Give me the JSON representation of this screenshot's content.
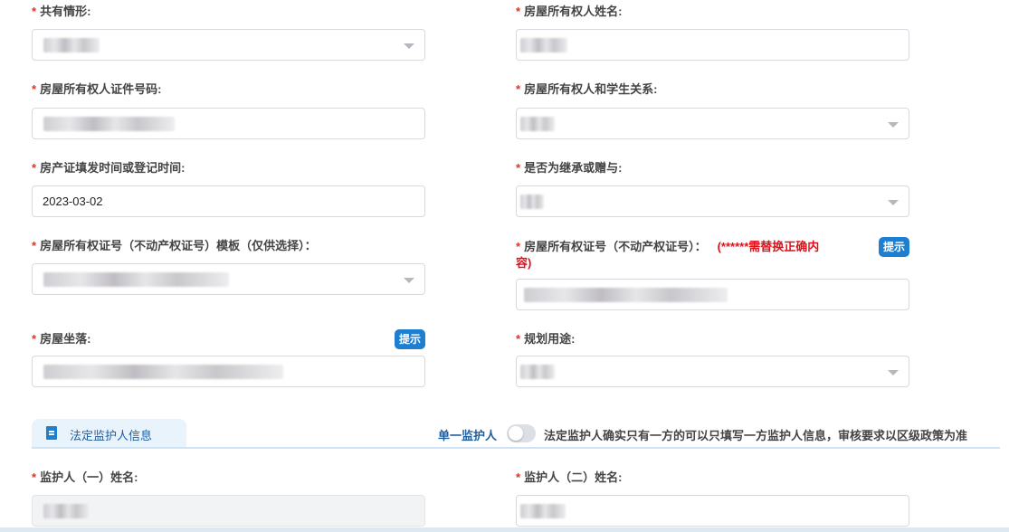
{
  "required_mark": "*",
  "fields": {
    "ownership": {
      "label": "共有情形:",
      "type": "select"
    },
    "owner_name": {
      "label": "房屋所有权人姓名:",
      "type": "input"
    },
    "owner_id_number": {
      "label": "房屋所有权人证件号码:",
      "type": "input"
    },
    "owner_relation": {
      "label": "房屋所有权人和学生关系:",
      "type": "select"
    },
    "cert_date": {
      "label": "房产证填发时间或登记时间:",
      "type": "input",
      "value": "2023-03-02"
    },
    "inherit_or_gift": {
      "label": "是否为继承或赠与:",
      "type": "select"
    },
    "cert_template": {
      "label": "房屋所有权证号（不动产权证号）模板（仅供选择）：",
      "type": "select"
    },
    "cert_number": {
      "label": "房屋所有权证号（不动产权证号）：",
      "warning_line1": "(******需替换正确内",
      "warning_line2": "容)",
      "hint_label": "提示",
      "type": "input"
    },
    "address": {
      "label": "房屋坐落:",
      "hint_label": "提示",
      "type": "input"
    },
    "planned_use": {
      "label": "规划用途:",
      "type": "select"
    },
    "guardian1_name": {
      "label": "监护人（一）姓名:",
      "type": "input",
      "disabled": true
    },
    "guardian2_name": {
      "label": "监护人（二）姓名:",
      "type": "input"
    }
  },
  "section": {
    "title": "法定监护人信息",
    "icon": "document-icon",
    "single_guardian_label": "单一监护人",
    "single_guardian_on": false,
    "note": "法定监护人确实只有一方的可以只填写一方监护人信息，审核要求以区级政策为准"
  },
  "colors": {
    "accent": "#1e7fd0",
    "required": "#e0312d",
    "warning": "#e0101a"
  }
}
